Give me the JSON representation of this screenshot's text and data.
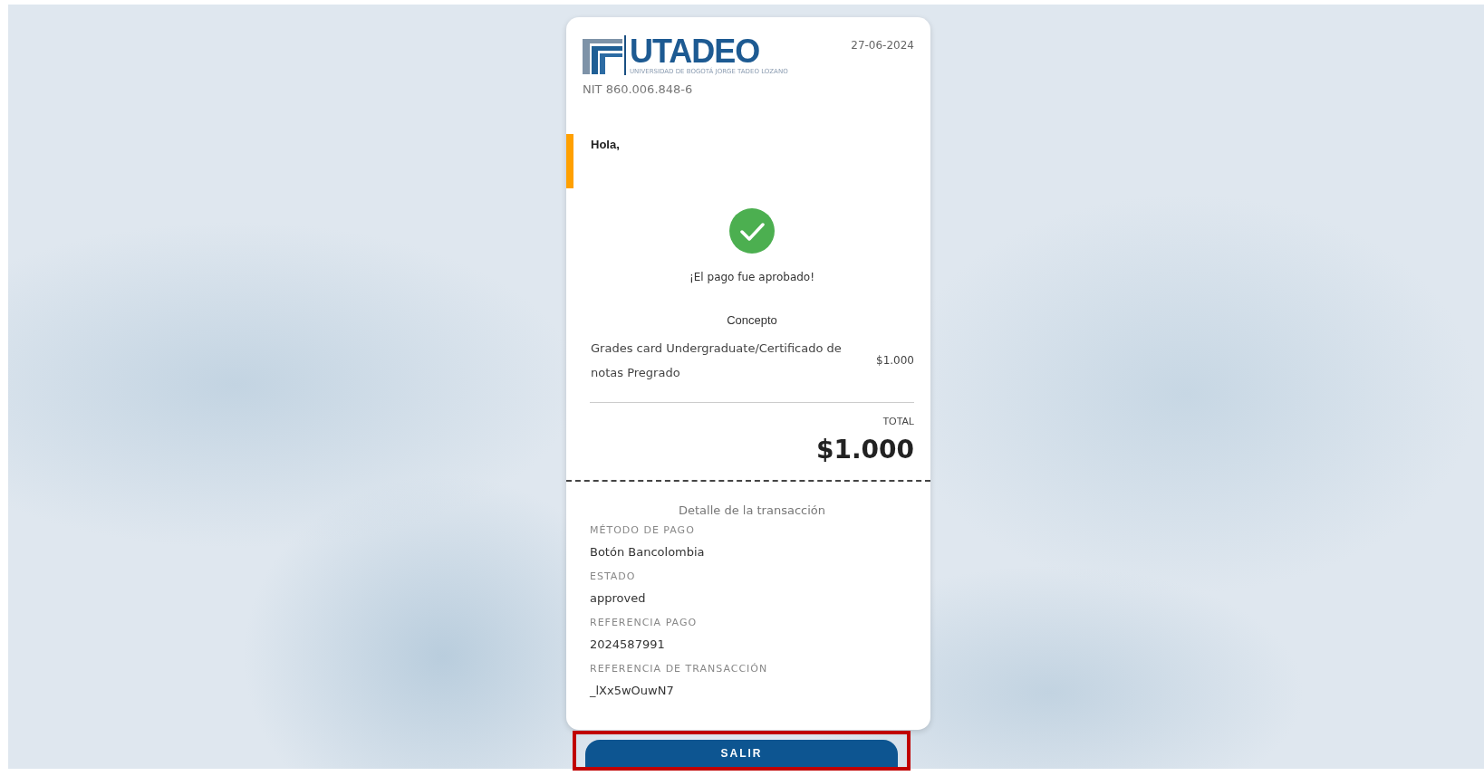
{
  "logo": {
    "name": "UTADEO",
    "subtitle": "UNIVERSIDAD DE BOGOTÁ JORGE TADEO LOZANO"
  },
  "date": "27-06-2024",
  "nit": "NIT 860.006.848-6",
  "greeting": "Hola,",
  "status": {
    "kind": "success",
    "message": "¡El pago fue aprobado!"
  },
  "concept": {
    "heading": "Concepto",
    "items": [
      {
        "description": "Grades card Undergraduate/Certificado de notas Pregrado",
        "amount": "$1.000"
      }
    ]
  },
  "total": {
    "label": "TOTAL",
    "amount": "$1.000"
  },
  "details": {
    "heading": "Detalle de la transacción",
    "fields": [
      {
        "label": "MÉTODO DE PAGO",
        "value": "Botón Bancolombia"
      },
      {
        "label": "ESTADO",
        "value": "approved"
      },
      {
        "label": "REFERENCIA PAGO",
        "value": "2024587991"
      },
      {
        "label": "REFERENCIA DE TRANSACCIÓN",
        "value": "_lXx5wOuwN7"
      }
    ]
  },
  "button": {
    "label": "SALIR",
    "highlighted": true
  }
}
